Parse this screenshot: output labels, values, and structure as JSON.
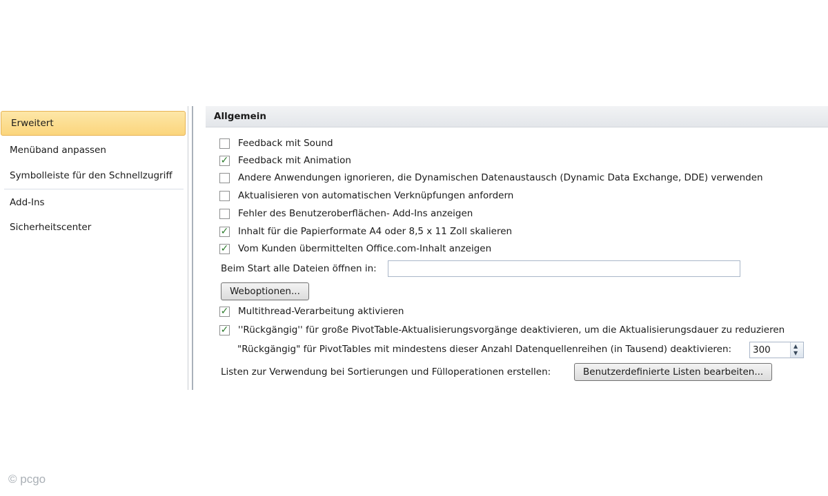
{
  "sidebar": {
    "items": [
      {
        "label": "Erweitert",
        "active": true
      },
      {
        "label": "Menüband anpassen",
        "active": false
      },
      {
        "label": "Symbolleiste für den Schnellzugriff",
        "active": false
      },
      {
        "label": "Add-Ins",
        "active": false
      },
      {
        "label": "Sicherheitscenter",
        "active": false
      }
    ]
  },
  "section": {
    "title": "Allgemein"
  },
  "options": [
    {
      "label": "Feedback mit Sound",
      "checked": false
    },
    {
      "label": "Feedback mit Animation",
      "checked": true
    },
    {
      "label": "Andere Anwendungen ignorieren, die Dynamischen Datenaustausch (Dynamic Data Exchange, DDE) verwenden",
      "checked": false
    },
    {
      "label": "Aktualisieren von automatischen Verknüpfungen anfordern",
      "checked": false
    },
    {
      "label": "Fehler des Benutzeroberflächen- Add-Ins anzeigen",
      "checked": false
    },
    {
      "label": "Inhalt für die Papierformate A4 oder 8,5 x 11 Zoll skalieren",
      "checked": true
    },
    {
      "label": "Vom Kunden übermittelten Office.com-Inhalt anzeigen",
      "checked": true
    }
  ],
  "startup": {
    "label": "Beim Start alle Dateien öffnen in:",
    "value": ""
  },
  "weboptions_button": "Weboptionen...",
  "options2": [
    {
      "label": "Multithread-Verarbeitung aktivieren",
      "checked": true
    },
    {
      "label": "''Rückgängig'' für große PivotTable-Aktualisierungsvorgänge deaktivieren, um die Aktualisierungsdauer zu reduzieren",
      "checked": true
    }
  ],
  "pivot": {
    "label": "\"Rückgängig\" für PivotTables mit mindestens dieser Anzahl Datenquellenreihen (in Tausend) deaktivieren:",
    "value": "300"
  },
  "lists": {
    "label": "Listen zur Verwendung bei Sortierungen und Fülloperationen erstellen:",
    "button": "Benutzerdefinierte Listen bearbeiten..."
  },
  "watermark": "pcgo"
}
